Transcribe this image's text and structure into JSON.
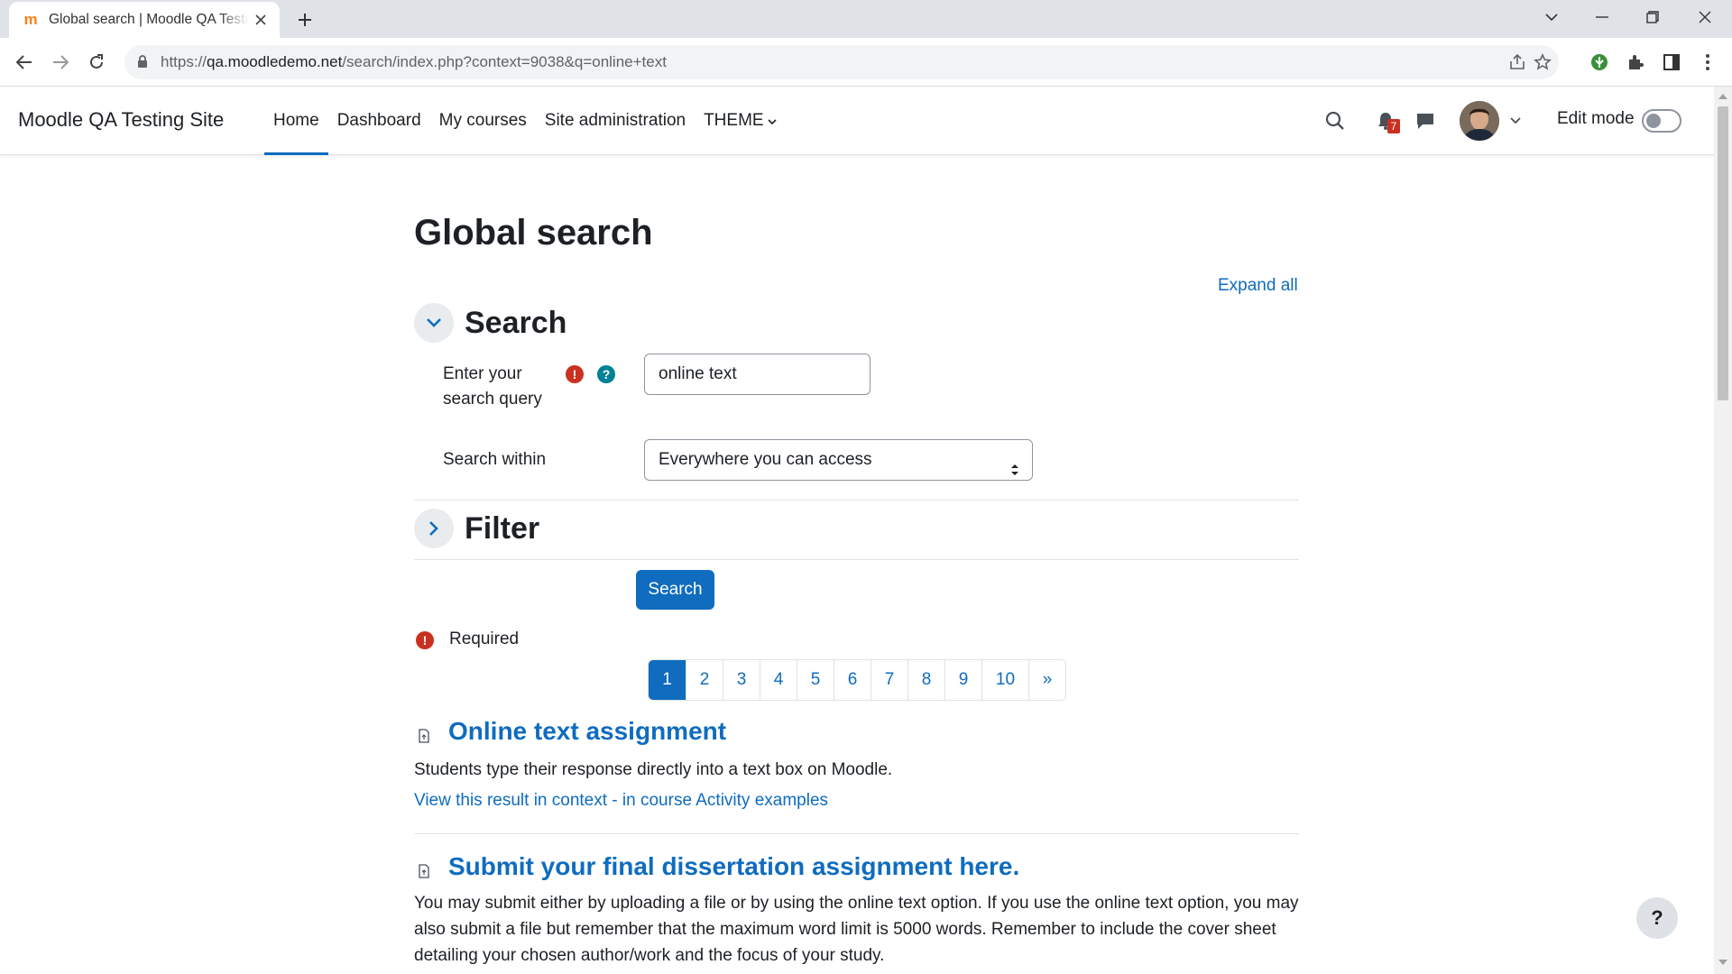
{
  "browser": {
    "tab_title": "Global search | Moodle QA Testing Site",
    "url_prefix": "https://",
    "url_host": "qa.moodledemo.net",
    "url_path": "/search/index.php?context=9038&q=online+text"
  },
  "navbar": {
    "site_name": "Moodle QA Testing Site",
    "items": [
      {
        "label": "Home",
        "active": true
      },
      {
        "label": "Dashboard",
        "active": false
      },
      {
        "label": "My courses",
        "active": false
      },
      {
        "label": "Site administration",
        "active": false
      },
      {
        "label": "THEME",
        "active": false
      }
    ],
    "notification_count": "7",
    "edit_mode_label": "Edit mode"
  },
  "page": {
    "title": "Global search",
    "expand_all": "Expand all"
  },
  "search_section": {
    "title": "Search",
    "query_label_line1": "Enter your",
    "query_label_line2": "search query",
    "query_value": "online text",
    "within_label": "Search within",
    "within_value": "Everywhere you can access"
  },
  "filter_section": {
    "title": "Filter"
  },
  "form": {
    "submit_label": "Search",
    "required_label": "Required"
  },
  "pagination": {
    "pages": [
      "1",
      "2",
      "3",
      "4",
      "5",
      "6",
      "7",
      "8",
      "9",
      "10",
      "»"
    ],
    "current": "1"
  },
  "results": [
    {
      "title": "Online text assignment",
      "description": "Students type their response directly into a text box on Moodle.",
      "context_link": "View this result in context",
      "separator": " - ",
      "course_link": "in course Activity examples"
    },
    {
      "title": "Submit your final dissertation assignment here.",
      "description": "You may submit either by uploading a file or by using the online text option. If you use the online text option, you may also submit a file but remember that the maximum word limit is 5000 words. Remember to include the cover sheet detailing your chosen author/work and the focus of your study."
    }
  ],
  "help_button": "?",
  "colors": {
    "primary": "#0f6cbf",
    "danger": "#ca3120",
    "info": "#008196",
    "text": "#1d2125"
  }
}
